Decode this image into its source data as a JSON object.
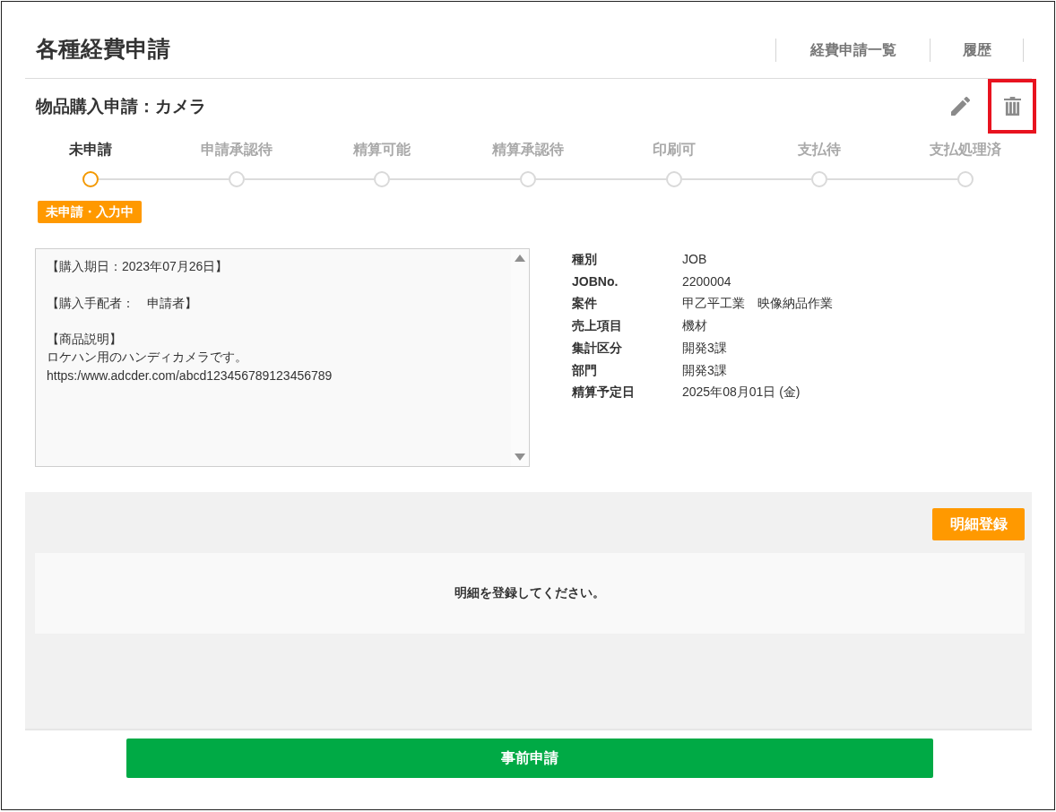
{
  "header": {
    "title": "各種経費申請",
    "nav": [
      {
        "label": "経費申請一覧"
      },
      {
        "label": "履歴"
      }
    ]
  },
  "request": {
    "title": "物品購入申請：カメラ",
    "actions": [
      {
        "kind": "edit",
        "highlighted": false
      },
      {
        "kind": "delete",
        "highlighted": true
      }
    ]
  },
  "steps": [
    {
      "label": "未申請",
      "selected": true
    },
    {
      "label": "申請承認待",
      "selected": false
    },
    {
      "label": "精算可能",
      "selected": false
    },
    {
      "label": "精算承認待",
      "selected": false
    },
    {
      "label": "印刷可",
      "selected": false
    },
    {
      "label": "支払待",
      "selected": false
    },
    {
      "label": "支払処理済",
      "selected": false
    }
  ],
  "status_badge": "未申請・入力中",
  "description": {
    "paragraphs": [
      {
        "lines": [
          "【購入期日：2023年07月26日】"
        ]
      },
      {
        "lines": [
          "【購入手配者：　申請者】"
        ]
      },
      {
        "lines": [
          "【商品説明】",
          "ロケハン用のハンディカメラです。",
          "https:/www.adcder.com/abcd123456789123456789"
        ]
      }
    ]
  },
  "details": [
    {
      "label": "種別",
      "value": "JOB"
    },
    {
      "label": "JOBNo.",
      "value": "2200004"
    },
    {
      "label": "案件",
      "value": "甲乙平工業　映像納品作業"
    },
    {
      "label": "売上項目",
      "value": "機材"
    },
    {
      "label": "集計区分",
      "value": "開発3課"
    },
    {
      "label": "部門",
      "value": "開発3課"
    },
    {
      "label": "精算予定日",
      "value": "2025年08月01日 (金)"
    }
  ],
  "line_items": {
    "add_button": "明細登録",
    "empty_message": "明細を登録してください。"
  },
  "submit_button": "事前申請"
}
